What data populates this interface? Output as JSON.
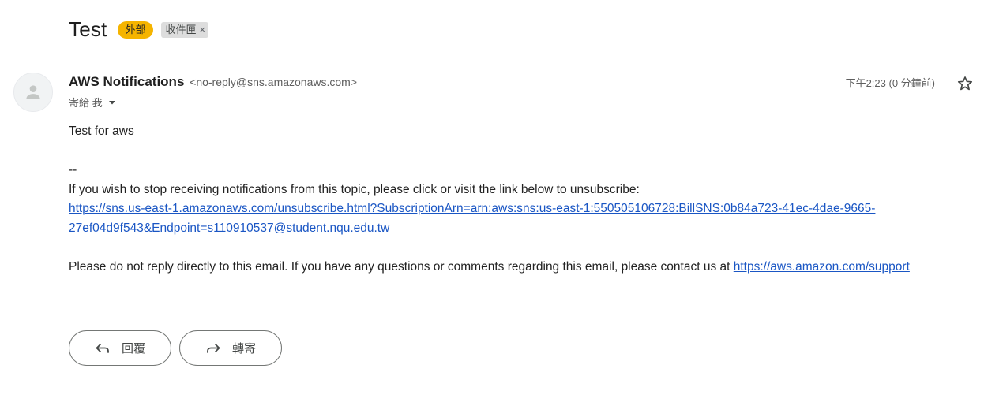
{
  "subject": {
    "title": "Test",
    "labels": [
      {
        "text": "外部",
        "color": "#f5b400"
      },
      {
        "text": "收件匣",
        "removable": true,
        "remove_glyph": "×"
      }
    ]
  },
  "message": {
    "sender_name": "AWS Notifications",
    "sender_email": "<no-reply@sns.amazonaws.com>",
    "to_text": "寄給 我",
    "timestamp": "下午2:23 (0 分鐘前)",
    "avatar_icon": "person-icon",
    "star_icon": "star-outline-icon"
  },
  "body": {
    "line1": "Test for aws",
    "separator": "--",
    "line2": "If you wish to stop receiving notifications from this topic, please click or visit the link below to unsubscribe:",
    "unsubscribe_link_part1": "https://sns.us-east-1.amazonaws.com/unsubscribe.html?SubscriptionArn=arn:aws:sns:us-east-1:550505106728:BillSNS:0b84a723-41ec-4dae-9665-",
    "unsubscribe_link_part2": "27ef04d9f543&Endpoint=s110910537@student.nqu.edu.tw",
    "line3": "Please do not reply directly to this email. If you have any questions or comments regarding this email, please contact us at",
    "support_link": "https://aws.amazon.com/support"
  },
  "actions": {
    "reply_label": "回覆",
    "forward_label": "轉寄"
  },
  "colors": {
    "link": "#1a56c4",
    "external_label": "#f5b400",
    "inbox_label": "#dddddd"
  }
}
